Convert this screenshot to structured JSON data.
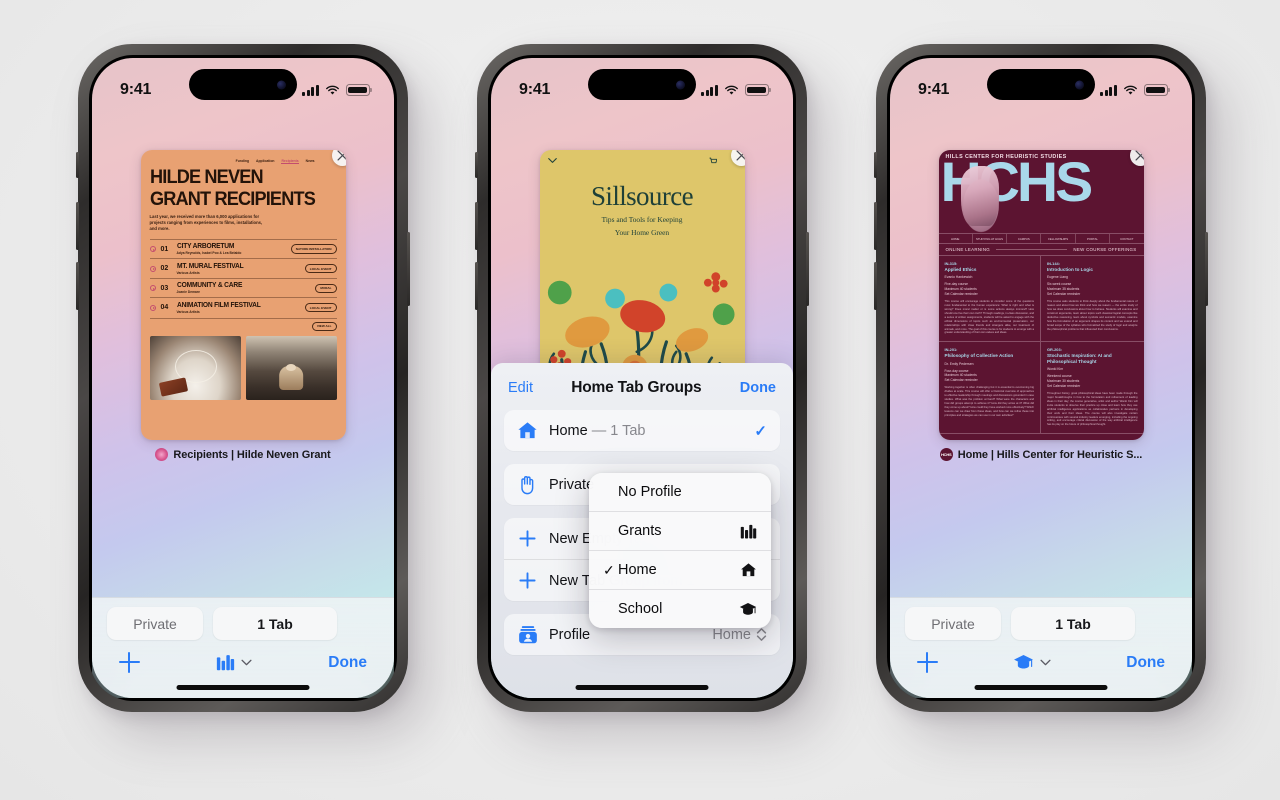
{
  "background_color": "#eeeeee",
  "accent_color": "#2a7cf7",
  "status_bar": {
    "time": "9:41",
    "signal_icon": "cellular-bars-icon",
    "wifi_icon": "wifi-icon",
    "battery_icon": "battery-icon"
  },
  "phones": [
    {
      "id": "phone-left",
      "tab_label": "Recipients | Hilde Neven Grant",
      "favicon_name": "hilde-neven-favicon",
      "favicon_color": "#d9568f",
      "page": {
        "theme_color": "#e8a172",
        "nav": [
          "Funding",
          "Application",
          "Recipients",
          "News"
        ],
        "nav_active": "Recipients",
        "title_line1": "HILDE NEVEN",
        "title_line2": "GRANT RECIPIENTS",
        "intro": "Last year, we received more than 6,000 applications for projects ranging from experiences to films, installations, and more.",
        "recipients": [
          {
            "num": "01",
            "title": "CITY ARBORETUM",
            "artists": "Adya Reynolds, Isabel Poo & Lea Belaldo",
            "tag": "NATURE INSTALLATION"
          },
          {
            "num": "02",
            "title": "MT. MURAL FESTIVAL",
            "artists": "Various Artists",
            "tag": "LOCAL EVENT"
          },
          {
            "num": "03",
            "title": "COMMUNITY & CARE",
            "artists": "Joanie Demare",
            "tag": "MURAL"
          },
          {
            "num": "04",
            "title": "ANIMATION FILM FESTIVAL",
            "artists": "Various Artists",
            "tag": "LOCAL EVENT"
          }
        ],
        "view_all": "VIEW ALL"
      },
      "bottom_bar": {
        "private_label": "Private",
        "tabs_label": "1 Tab",
        "new_tab_icon": "plus-icon",
        "group_icon": "books-icon",
        "group_chevron_icon": "chevron-down-icon",
        "done_label": "Done"
      }
    },
    {
      "id": "phone-center",
      "page": {
        "theme_color": "#dec66a",
        "chevron_icon": "chevron-down-icon",
        "cart_icon": "cart-icon",
        "title": "Sillsource",
        "subtitle_line1": "Tips and Tools for Keeping",
        "subtitle_line2": "Your Home Green"
      },
      "sheet": {
        "edit_label": "Edit",
        "title": "Home Tab Groups",
        "done_label": "Done",
        "rows": [
          {
            "icon": "house-icon",
            "label": "Home",
            "suffix": " — 1 Tab",
            "checked": true
          },
          {
            "icon": "hand-raised-icon",
            "label": "Private",
            "suffix": "",
            "checked": false
          },
          {
            "icon": "plus-icon",
            "label": "New Empty Tab Group",
            "suffix": "",
            "checked": false
          },
          {
            "icon": "plus-icon",
            "label": "New Tab Group from 1 Tab",
            "suffix": "",
            "checked": false
          }
        ],
        "profile_row": {
          "icon": "profile-card-icon",
          "label": "Profile",
          "value": "Home",
          "chevron_icon": "up-down-chevron-icon"
        }
      },
      "context_menu": {
        "items": [
          {
            "label": "No Profile",
            "icon": "",
            "checked": false
          },
          {
            "label": "Grants",
            "icon": "books-icon",
            "checked": false
          },
          {
            "label": "Home",
            "icon": "house-icon",
            "checked": true
          },
          {
            "label": "School",
            "icon": "graduation-cap-icon",
            "checked": false
          }
        ]
      }
    },
    {
      "id": "phone-right",
      "tab_label": "Home | Hills Center for Heuristic S...",
      "favicon_name": "hchs-favicon",
      "favicon_text": "HCHS",
      "favicon_color": "#5c1431",
      "page": {
        "theme_color": "#5c1431",
        "header": "HILLS CENTER FOR HEURISTIC STUDIES",
        "wordmark": "HCHS",
        "nav": [
          "HOME",
          "STUDYING AT HCHS",
          "CAMPUS",
          "FELLOWSHIPS",
          "PORTAL",
          "CONTACT"
        ],
        "section_left": "ONLINE LEARNING",
        "section_right": "NEW COURSE OFFERINGS",
        "courses": [
          {
            "code": "IN-315:",
            "name": "Applied Ethics",
            "instructor": "Evanio Hankewich",
            "meta": "Five-day course\nMaximum 40 students\nSet Calendar reminder",
            "body": "This course will encourage students to consider some of the questions most fundamental to the human experience: What is right and what is wrong? Does moral matter or is some actions always immoral? How should one live their own truth? Through readings, in-class discussion, and a series of written assignments, students will be asked to engage with the ethical dimensions of topics such as environmental preservation, our relationships with close friends and strangers alike, our treatment of animals, and more. The goal of this course is for students to emerge with a greater understanding of their own values and ideas."
          },
          {
            "code": "IN-144:",
            "name": "Introduction to Logic",
            "instructor": "Eugene Liang",
            "meta": "Six-week course\nMaximum 35 students\nSet Calendar reminder",
            "body": "This course asks students to think deeply about the fundamental nature of reason and about how we think and how we reason — the entire study of how we draw conclusions about how to behave. Students will examine and construct arguments, learn about topics such classical logical concepts like deductive reasoning, learn about symbols and semantic models, examine how the formulation of an argument shapes its content and we extend and broad scope of the syllabus who formalized the study of logic and analyze the philosophical problems that influenced their conclusions."
          },
          {
            "code": "IN-201:",
            "name": "Philosophy of Collective Action",
            "instructor": "Dr. Emily Pedersen",
            "meta": "Four-day course\nMaximum 40 students\nSet Calendar reminder",
            "body": "Working together is often challenging but it is essential to overcoming big divides at scale. This course will offer a historical overview of approaches to effective leadership through meetings and discussions grounded in case studies. What was the problem at hand? What were the characters and how did groups attempt to achieve it? How did they arrive at it? What did they come up about? How could they have worked more effectively? Which lessons can we draw from these ideas, and how can we refine these into principles and strategies we can use in our own activities?"
          },
          {
            "code": "GR-203:",
            "name": "Stochastic Inspiration: AI and Philosophical Thought",
            "instructor": "Wonki Kim",
            "meta": "Weekend course\nMaximum 30 students\nSet Calendar reminder",
            "body": "Throughout history, great philosophical ideas have been made through the major breakthroughs in how to the formulation and refinement of leading ideas in their day; the course generative, artist and author Wonki Kim will invite students to observe their practice up close and learn how they use artificial intelligence applications as collaborative partners in developing their work and their ideas. The course will also investigate certain controversies with several industry leaders emerging, including the ongoing writing, and encourage critical discussion of the way artificial intelligence has its play on the future of philosophical thought."
          }
        ]
      },
      "bottom_bar": {
        "private_label": "Private",
        "tabs_label": "1 Tab",
        "new_tab_icon": "plus-icon",
        "group_icon": "graduation-cap-icon",
        "group_chevron_icon": "chevron-down-icon",
        "done_label": "Done"
      }
    }
  ]
}
